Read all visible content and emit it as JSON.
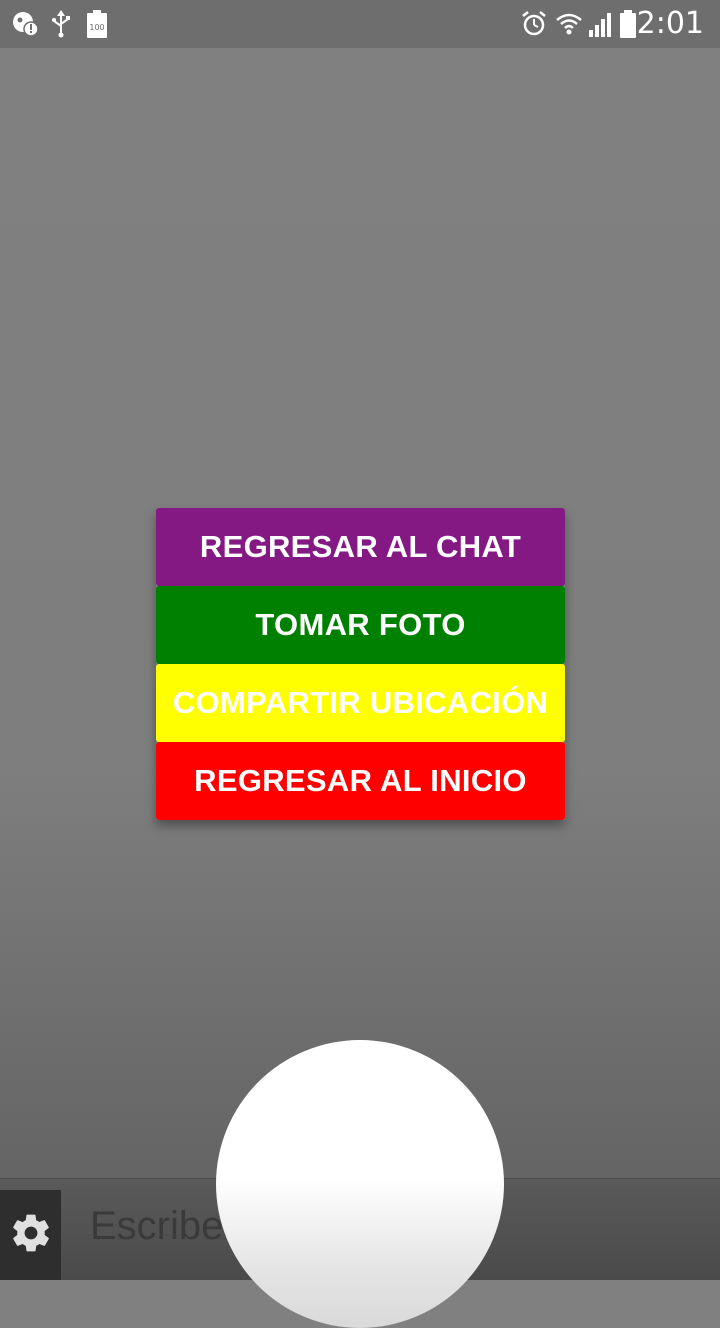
{
  "status_bar": {
    "time": "2:01",
    "battery_small_label": "100",
    "left_icons": [
      "notification-icon",
      "usb-icon",
      "battery-saver-icon"
    ],
    "right_icons": [
      "alarm-icon",
      "wifi-icon",
      "signal-icon",
      "battery-icon"
    ]
  },
  "menu": {
    "items": [
      {
        "label": "REGRESAR AL CHAT",
        "color": "#841984"
      },
      {
        "label": "TOMAR FOTO",
        "color": "#008000"
      },
      {
        "label": "COMPARTIR UBICACIÓN",
        "color": "#FFFF00"
      },
      {
        "label": "REGRESAR AL INICIO",
        "color": "#FF0000"
      }
    ]
  },
  "compose": {
    "input_value": "Escribe",
    "settings_icon": "gear-icon"
  }
}
